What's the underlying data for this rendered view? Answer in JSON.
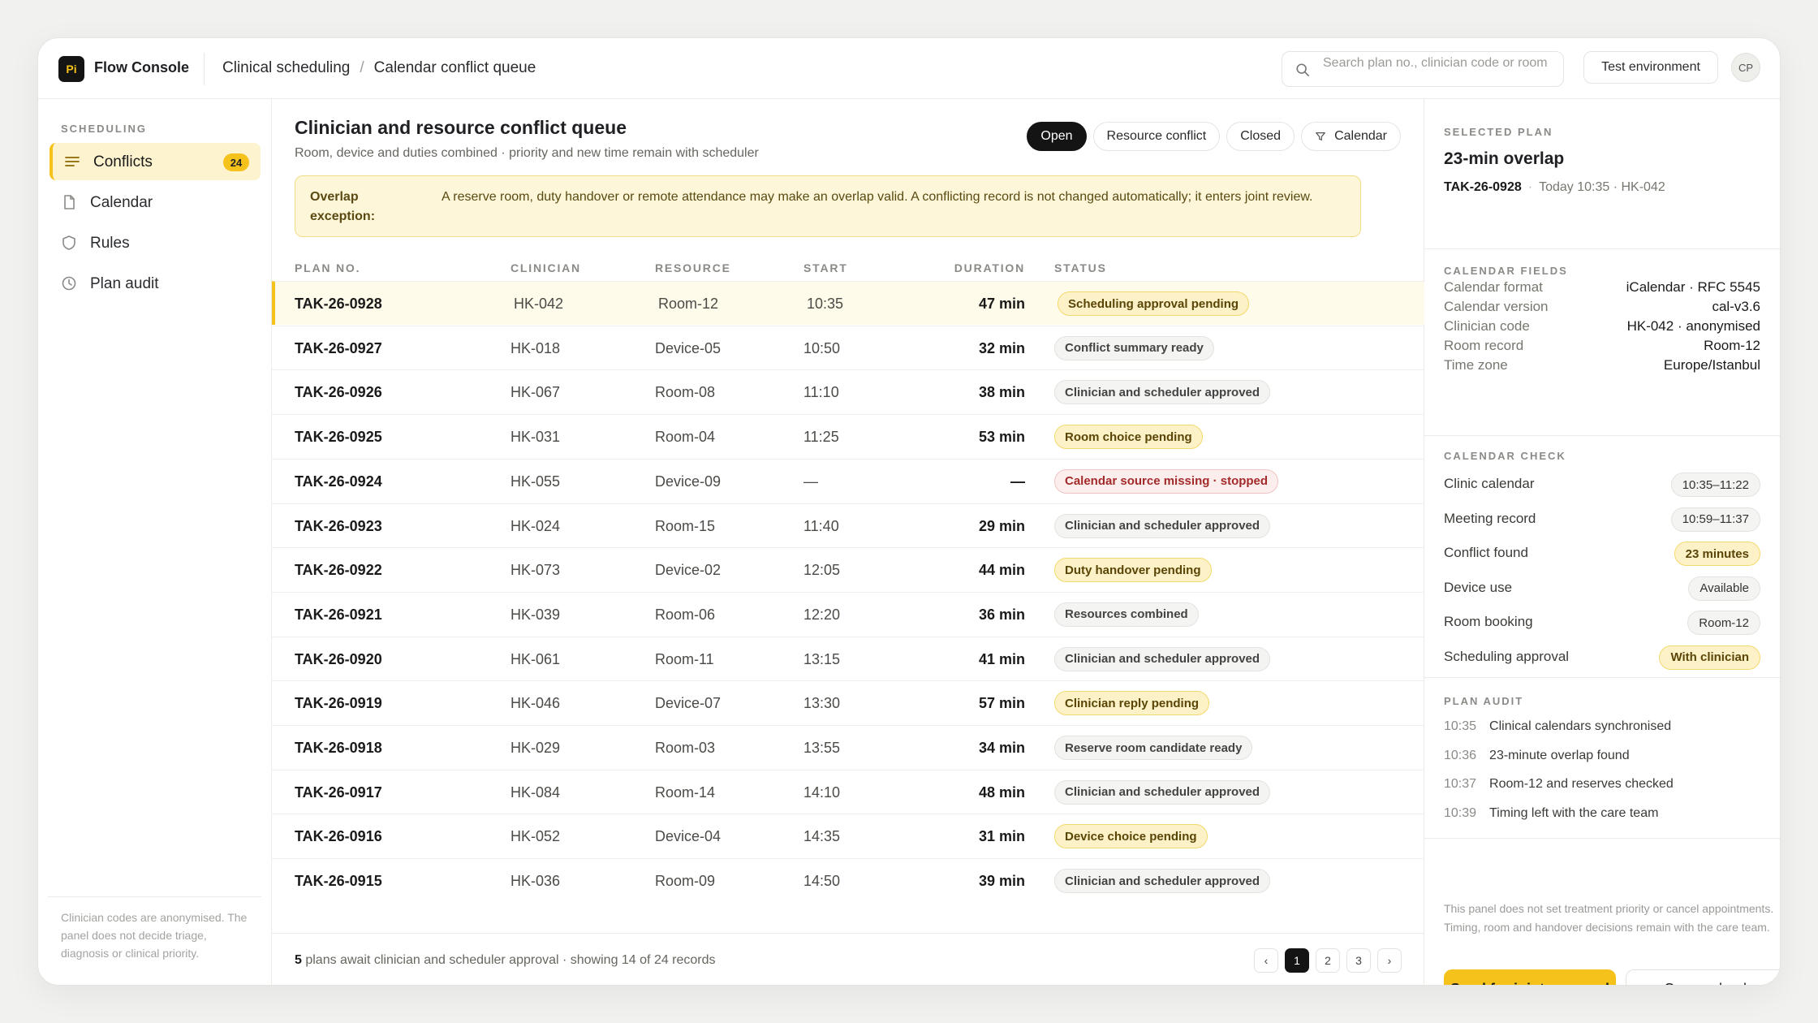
{
  "app": {
    "logo": "Pi",
    "name": "Flow Console"
  },
  "breadcrumb": [
    "Clinical scheduling",
    "Calendar conflict queue"
  ],
  "search": {
    "placeholder": "Search plan no., clinician code or room",
    "icon": "search-icon"
  },
  "environment": "Test environment",
  "user": {
    "initials": "CP"
  },
  "sidebar": {
    "heading": "SCHEDULING",
    "items": [
      {
        "label": "Conflicts",
        "icon": "list-icon",
        "badge": "24",
        "active": true
      },
      {
        "label": "Calendar",
        "icon": "document-icon"
      },
      {
        "label": "Rules",
        "icon": "shield-icon"
      },
      {
        "label": "Plan audit",
        "icon": "clock-icon"
      }
    ],
    "note": "Clinician codes are anonymised. The panel does not decide triage, diagnosis or clinical priority."
  },
  "main": {
    "title": "Clinician and resource conflict queue",
    "subtitle": "Room, device and duties combined · priority and new time remain with scheduler",
    "filters": [
      {
        "label": "Open",
        "active": true
      },
      {
        "label": "Resource conflict"
      },
      {
        "label": "Closed"
      },
      {
        "label": "Calendar",
        "icon": "filter-icon"
      }
    ],
    "notice": {
      "label": "Overlap exception:",
      "text": "A reserve room, duty handover or remote attendance may make an overlap valid. A conflicting record is not changed automatically; it enters joint review."
    },
    "columns": [
      "PLAN NO.",
      "CLINICIAN",
      "RESOURCE",
      "START",
      "DURATION",
      "STATUS"
    ],
    "rows": [
      {
        "id": "TAK-26-0928",
        "clinician": "HK-042",
        "resource": "Room-12",
        "start": "10:35",
        "duration": "47 min",
        "status": "Scheduling approval pending",
        "tone": "yellow",
        "selected": true
      },
      {
        "id": "TAK-26-0927",
        "clinician": "HK-018",
        "resource": "Device-05",
        "start": "10:50",
        "duration": "32 min",
        "status": "Conflict summary ready",
        "tone": "grey"
      },
      {
        "id": "TAK-26-0926",
        "clinician": "HK-067",
        "resource": "Room-08",
        "start": "11:10",
        "duration": "38 min",
        "status": "Clinician and scheduler approved",
        "tone": "grey"
      },
      {
        "id": "TAK-26-0925",
        "clinician": "HK-031",
        "resource": "Room-04",
        "start": "11:25",
        "duration": "53 min",
        "status": "Room choice pending",
        "tone": "yellow"
      },
      {
        "id": "TAK-26-0924",
        "clinician": "HK-055",
        "resource": "Device-09",
        "start": "—",
        "duration": "—",
        "status": "Calendar source missing · stopped",
        "tone": "red"
      },
      {
        "id": "TAK-26-0923",
        "clinician": "HK-024",
        "resource": "Room-15",
        "start": "11:40",
        "duration": "29 min",
        "status": "Clinician and scheduler approved",
        "tone": "grey"
      },
      {
        "id": "TAK-26-0922",
        "clinician": "HK-073",
        "resource": "Device-02",
        "start": "12:05",
        "duration": "44 min",
        "status": "Duty handover pending",
        "tone": "yellow"
      },
      {
        "id": "TAK-26-0921",
        "clinician": "HK-039",
        "resource": "Room-06",
        "start": "12:20",
        "duration": "36 min",
        "status": "Resources combined",
        "tone": "grey"
      },
      {
        "id": "TAK-26-0920",
        "clinician": "HK-061",
        "resource": "Room-11",
        "start": "13:15",
        "duration": "41 min",
        "status": "Clinician and scheduler approved",
        "tone": "grey"
      },
      {
        "id": "TAK-26-0919",
        "clinician": "HK-046",
        "resource": "Device-07",
        "start": "13:30",
        "duration": "57 min",
        "status": "Clinician reply pending",
        "tone": "yellow"
      },
      {
        "id": "TAK-26-0918",
        "clinician": "HK-029",
        "resource": "Room-03",
        "start": "13:55",
        "duration": "34 min",
        "status": "Reserve room candidate ready",
        "tone": "grey"
      },
      {
        "id": "TAK-26-0917",
        "clinician": "HK-084",
        "resource": "Room-14",
        "start": "14:10",
        "duration": "48 min",
        "status": "Clinician and scheduler approved",
        "tone": "grey"
      },
      {
        "id": "TAK-26-0916",
        "clinician": "HK-052",
        "resource": "Device-04",
        "start": "14:35",
        "duration": "31 min",
        "status": "Device choice pending",
        "tone": "yellow"
      },
      {
        "id": "TAK-26-0915",
        "clinician": "HK-036",
        "resource": "Room-09",
        "start": "14:50",
        "duration": "39 min",
        "status": "Clinician and scheduler approved",
        "tone": "grey"
      }
    ],
    "footer": {
      "count": "5",
      "text": " plans await clinician and scheduler approval · showing 14 of 24 records"
    },
    "pager": {
      "prev": "‹",
      "pages": [
        "1",
        "2",
        "3"
      ],
      "current": "1",
      "next": "›"
    }
  },
  "panel": {
    "selected_heading": "SELECTED PLAN",
    "title": "23-min overlap",
    "plan_id": "TAK-26-0928",
    "meta": "Today 10:35 · HK-042",
    "fields_heading": "CALENDAR FIELDS",
    "fields": [
      {
        "k": "Calendar format",
        "v": "iCalendar · RFC 5545"
      },
      {
        "k": "Calendar version",
        "v": "cal-v3.6"
      },
      {
        "k": "Clinician code",
        "v": "HK-042 · anonymised"
      },
      {
        "k": "Room record",
        "v": "Room-12"
      },
      {
        "k": "Time zone",
        "v": "Europe/Istanbul"
      }
    ],
    "check_heading": "CALENDAR CHECK",
    "checks": [
      {
        "k": "Clinic calendar",
        "v": "10:35–11:22",
        "tone": "g"
      },
      {
        "k": "Meeting record",
        "v": "10:59–11:37",
        "tone": "g"
      },
      {
        "k": "Conflict found",
        "v": "23 minutes",
        "tone": "y"
      },
      {
        "k": "Device use",
        "v": "Available",
        "tone": "g"
      },
      {
        "k": "Room booking",
        "v": "Room-12",
        "tone": "g"
      },
      {
        "k": "Scheduling approval",
        "v": "With clinician",
        "tone": "y"
      }
    ],
    "audit_heading": "PLAN AUDIT",
    "audit": [
      {
        "t": "10:35",
        "text": "Clinical calendars synchronised"
      },
      {
        "t": "10:36",
        "text": "23-minute overlap found"
      },
      {
        "t": "10:37",
        "text": "Room-12 and reserves checked"
      },
      {
        "t": "10:39",
        "text": "Timing left with the care team"
      }
    ],
    "note": "This panel does not set treatment priority or cancel appointments. Timing, room and handover decisions remain with the care team.",
    "primary_button": "Send for joint approval",
    "secondary_button": "Open calendar"
  },
  "colors": {
    "accent": "#f4c21b",
    "dark": "#141414",
    "danger": "#a32a2a"
  }
}
